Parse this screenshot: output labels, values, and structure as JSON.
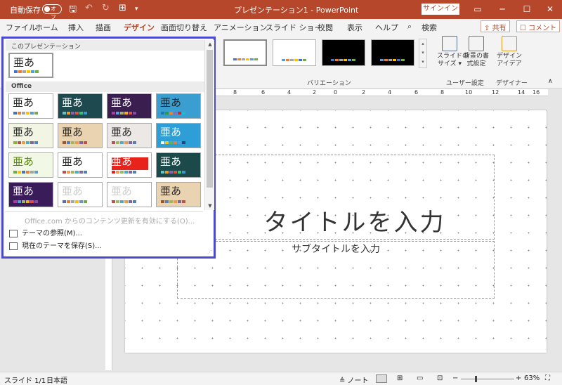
{
  "titlebar": {
    "autosave_label": "自動保存",
    "autosave_state": "オフ",
    "doc_title": "プレゼンテーション1 - PowerPoint",
    "signin_label": "サインイン",
    "buttons": [
      "▭",
      "─",
      "☐",
      "✕"
    ]
  },
  "tabs": [
    "ファイル",
    "ホーム",
    "挿入",
    "描画",
    "デザイン",
    "画面切り替え",
    "アニメーション",
    "スライド ショー",
    "校閲",
    "表示",
    "ヘルプ",
    "検索"
  ],
  "share_label": "共有",
  "comment_label": "コメント",
  "ribbon": {
    "variation_label": "バリエーション",
    "user_settings_label": "ユーザー設定",
    "designer_label": "デザイナー",
    "slide_size": "スライドの\nサイズ ▾",
    "background_format": "背景の書\n式設定",
    "design_ideas": "デザイン\nアイデア"
  },
  "ruler_ticks": [
    "8",
    "6",
    "4",
    "2",
    "0",
    "2",
    "4",
    "6",
    "8",
    "10",
    "12",
    "14",
    "16"
  ],
  "slide": {
    "title_placeholder": "タイトルを入力",
    "subtitle_placeholder": "サブタイトルを入力"
  },
  "statusbar": {
    "slide_info": "スライド 1/1",
    "language": "日本語",
    "notes": "≜ ノート",
    "zoom": "63%"
  },
  "dropdown": {
    "this_presentation": "このプレゼンテーション",
    "office_header": "Office",
    "theme_glyph": "亜あ",
    "update_link": "Office.com からのコンテンツ更新を有効にする(O)...",
    "browse_themes": "テーマの参照(M)...",
    "save_theme": "現在のテーマを保存(S)..."
  },
  "colors": {
    "accent": "#b7472a",
    "dropdown_border": "#4a4ad0"
  }
}
